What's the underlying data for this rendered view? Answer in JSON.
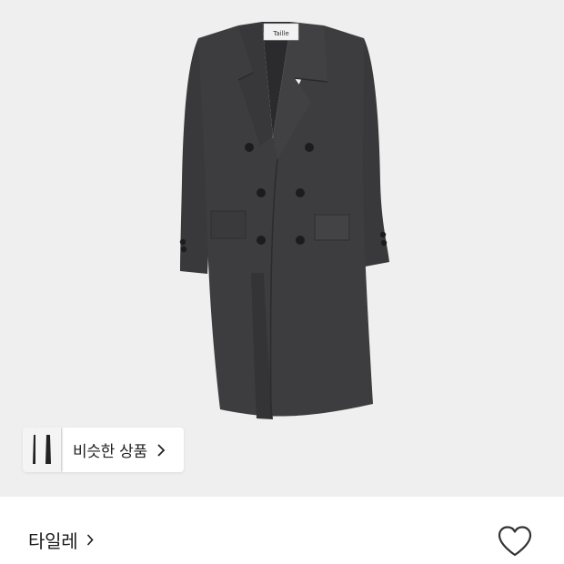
{
  "product": {
    "label_tag": "Taille",
    "background_color": "#efefef",
    "coat_color": "#3d3d3f"
  },
  "similar_chip": {
    "label": "비슷한 상품",
    "chevron_icon": "chevron-right-icon"
  },
  "brand": {
    "name": "타일레",
    "chevron_icon": "chevron-right-icon"
  },
  "wishlist": {
    "icon": "heart-outline-icon",
    "liked": false,
    "icon_color": "#333333"
  }
}
